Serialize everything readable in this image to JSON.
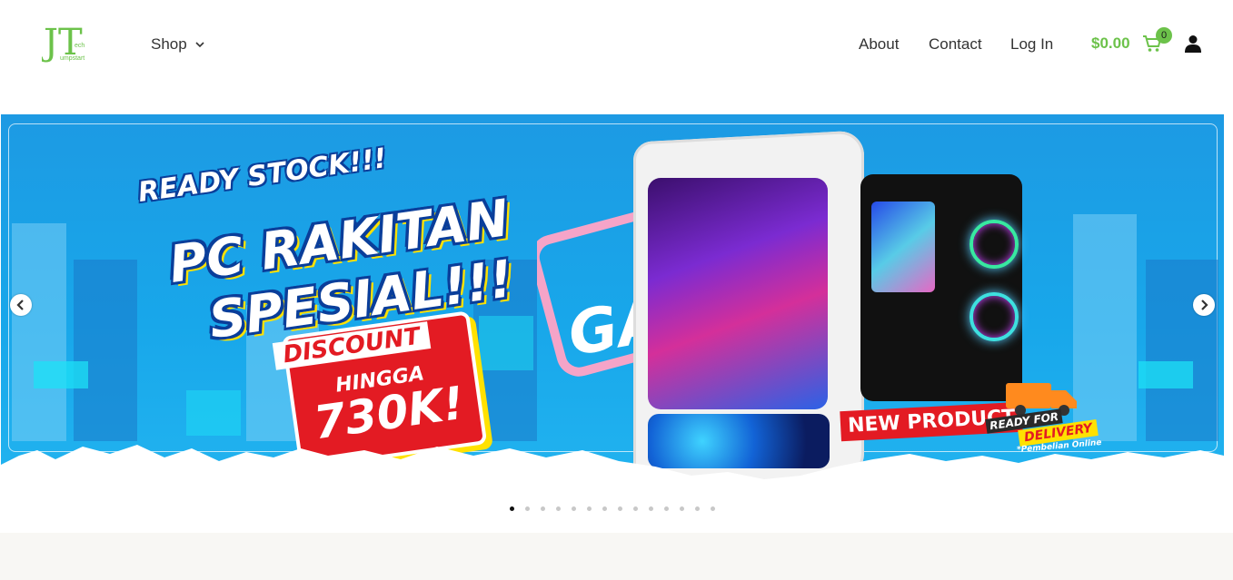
{
  "header": {
    "logo_alt": "Jumpstart Tech",
    "logo_letters": "JT",
    "logo_small_1": "ech",
    "logo_small_2": "umpstart",
    "nav": {
      "shop_label": "Shop",
      "about_label": "About",
      "contact_label": "Contact",
      "login_label": "Log In"
    },
    "cart": {
      "total": "$0.00",
      "count": "0"
    },
    "icons": {
      "cart": "cart-icon",
      "user": "user-icon",
      "dropdown": "chevron-down-icon"
    }
  },
  "hero": {
    "slide": {
      "line1": "READY STOCK!!!",
      "line2": "PC RAKITAN",
      "line3": "SPESIAL!!!",
      "discount": "DISCOUNT",
      "hingga": "HINGGA",
      "amount": "730K!",
      "bg_word": "GAM",
      "badge_new": "NEW PRODUCT",
      "badge_delivery_1": "READY FOR",
      "badge_delivery_2": "DELIVERY",
      "badge_delivery_note": "*Pembelian Online"
    },
    "carousel": {
      "slide_count": 14,
      "active_index": 0
    },
    "colors": {
      "accent_green": "#6cc24a",
      "banner_blue": "#1d9ae3",
      "discount_red": "#e31b23",
      "banner_yellow": "#ffe100"
    }
  }
}
